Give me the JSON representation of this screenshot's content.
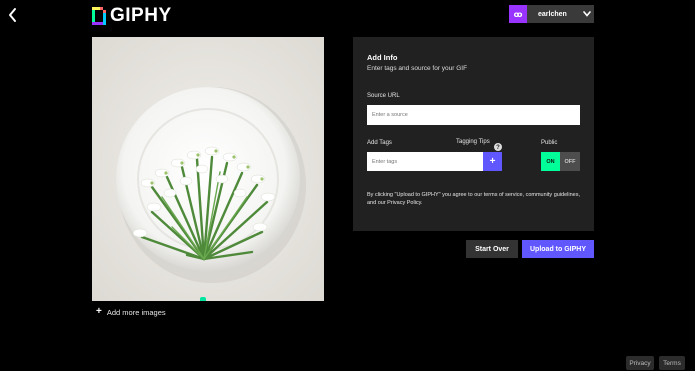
{
  "header": {
    "logo_text": "GIPHY",
    "user": {
      "avatar_text": "ꝏ",
      "name": "earlchen"
    }
  },
  "upload_preview": {
    "add_more_label": "Add more images"
  },
  "info_panel": {
    "title": "Add Info",
    "subtitle": "Enter tags and source for your GIF",
    "source_label": "Source URL",
    "source_placeholder": "Enter a source",
    "tags_label": "Add Tags",
    "tagging_tips_label": "Tagging Tips",
    "tags_placeholder": "Enter tags",
    "public_label": "Public",
    "toggle_on": "ON",
    "toggle_off": "OFF",
    "terms_text": "By clicking \"Upload to GIPHY\" you agree to our terms of service, community guidelines, and our Privacy Policy."
  },
  "actions": {
    "start_over": "Start Over",
    "upload": "Upload to GIPHY"
  },
  "footer": {
    "privacy": "Privacy",
    "terms": "Terms"
  },
  "colors": {
    "accent": "#6157ff",
    "toggle_on": "#00ff99",
    "avatar": "#9933ff",
    "panel": "#212121"
  }
}
